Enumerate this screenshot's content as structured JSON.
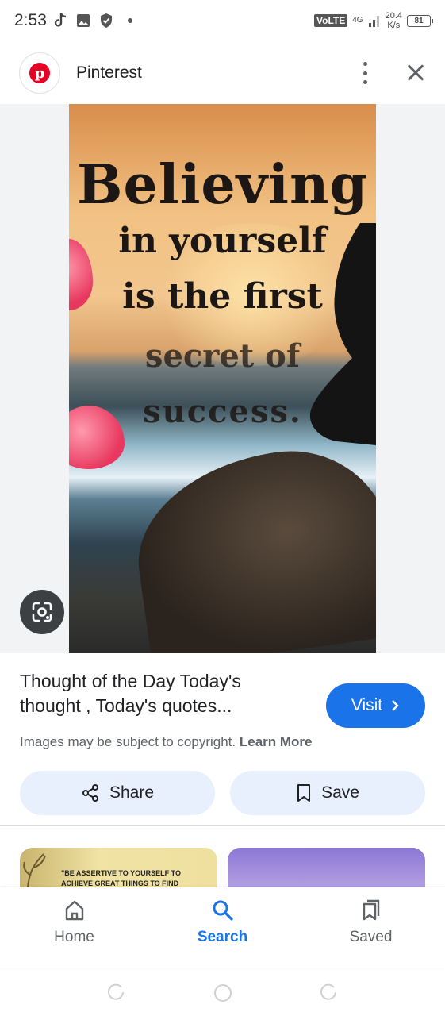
{
  "status_bar": {
    "time": "2:53",
    "network_type": "VoLTE",
    "network_gen": "4G",
    "speed_value": "20.4",
    "speed_unit": "K/s",
    "battery": "81"
  },
  "header": {
    "app_name": "Pinterest",
    "logo_letter": "p"
  },
  "image": {
    "quote_lines": [
      "Believing",
      "in yourself",
      "is the first",
      "secret of",
      "success."
    ]
  },
  "pin": {
    "title": "Thought of the Day Today's thought , Today's quotes...",
    "visit_label": "Visit",
    "copyright_text": "Images may be subject to copyright.",
    "learn_more_label": "Learn More",
    "share_label": "Share",
    "save_label": "Save"
  },
  "related": {
    "thumb_1_text": "\"BE ASSERTIVE TO YOURSELF TO ACHIEVE GREAT THINGS TO FIND"
  },
  "bottom_nav": {
    "items": [
      {
        "label": "Home",
        "icon": "home-icon"
      },
      {
        "label": "Search",
        "icon": "search-icon"
      },
      {
        "label": "Saved",
        "icon": "saved-icon"
      }
    ],
    "active": "Search"
  },
  "colors": {
    "accent": "#1a73e8",
    "pill_bg": "#e8f0fe",
    "pinterest_red": "#e60023"
  }
}
